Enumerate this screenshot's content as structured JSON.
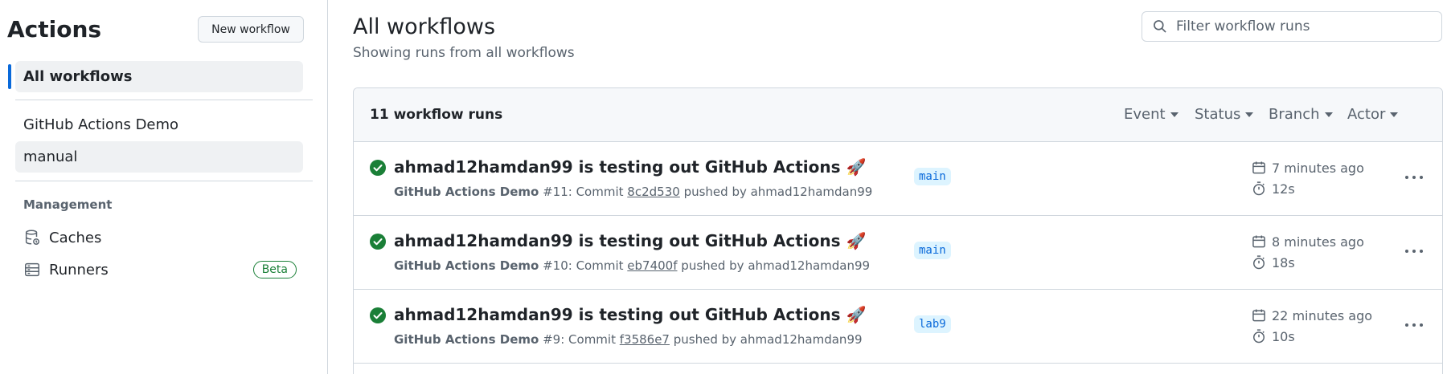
{
  "sidebar": {
    "title": "Actions",
    "new_workflow": "New workflow",
    "all_workflows": "All workflows",
    "workflows": [
      "GitHub Actions Demo",
      "manual"
    ],
    "management_heading": "Management",
    "caches": "Caches",
    "runners": "Runners",
    "runners_badge": "Beta"
  },
  "main": {
    "title": "All workflows",
    "subtitle": "Showing runs from all workflows",
    "filter_placeholder": "Filter workflow runs",
    "runs_count": "11 workflow runs",
    "filters": [
      "Event",
      "Status",
      "Branch",
      "Actor"
    ]
  },
  "runs": [
    {
      "title": "ahmad12hamdan99 is testing out GitHub Actions 🚀",
      "workflow": "GitHub Actions Demo",
      "number": "#11: Commit",
      "sha": "8c2d530",
      "pusher": "pushed by ahmad12hamdan99",
      "branch": "main",
      "time": "7 minutes ago",
      "duration": "12s"
    },
    {
      "title": "ahmad12hamdan99 is testing out GitHub Actions 🚀",
      "workflow": "GitHub Actions Demo",
      "number": "#10: Commit",
      "sha": "eb7400f",
      "pusher": "pushed by ahmad12hamdan99",
      "branch": "main",
      "time": "8 minutes ago",
      "duration": "18s"
    },
    {
      "title": "ahmad12hamdan99 is testing out GitHub Actions 🚀",
      "workflow": "GitHub Actions Demo",
      "number": "#9: Commit",
      "sha": "f3586e7",
      "pusher": "pushed by ahmad12hamdan99",
      "branch": "lab9",
      "time": "22 minutes ago",
      "duration": "10s"
    }
  ],
  "colors": {
    "accent": "#0969da",
    "success": "#1a7f37",
    "border": "#d0d7de",
    "muted": "#59636e"
  }
}
